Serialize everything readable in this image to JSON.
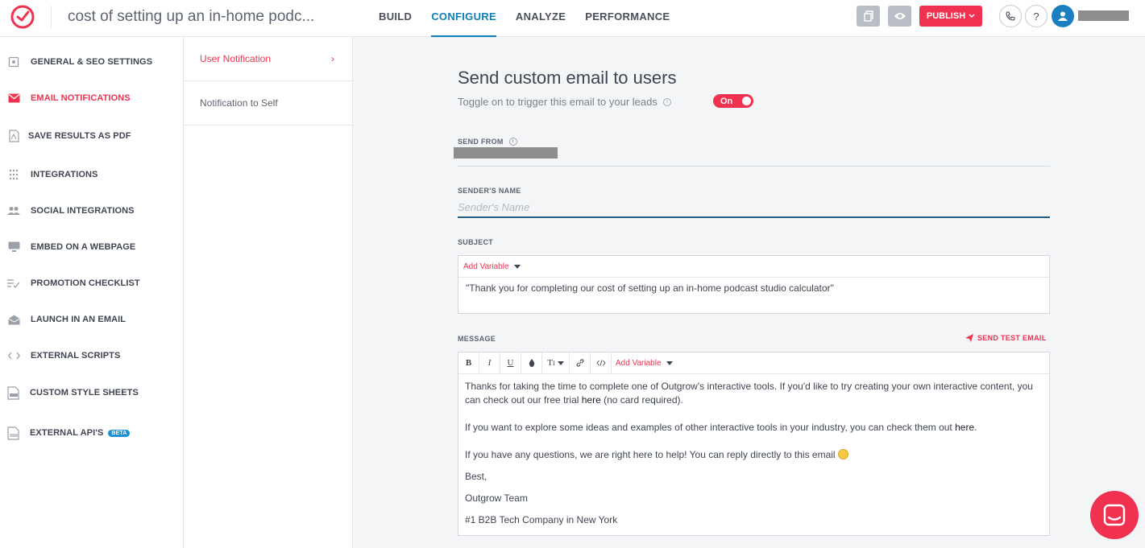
{
  "app": {
    "title": "cost of setting up an in-home podc..."
  },
  "nav": {
    "tabs": [
      {
        "label": "BUILD"
      },
      {
        "label": "CONFIGURE",
        "active": true
      },
      {
        "label": "ANALYZE"
      },
      {
        "label": "PERFORMANCE"
      }
    ]
  },
  "toolbar": {
    "publish_label": "PUBLISH",
    "help_label": "?"
  },
  "sidebar": {
    "items": [
      {
        "label": "GENERAL & SEO SETTINGS",
        "icon": "settings-icon"
      },
      {
        "label": "EMAIL NOTIFICATIONS",
        "icon": "mail-icon",
        "active": true
      },
      {
        "label": "SAVE RESULTS AS PDF",
        "icon": "pdf-icon"
      },
      {
        "label": "INTEGRATIONS",
        "icon": "grid-icon"
      },
      {
        "label": "SOCIAL INTEGRATIONS",
        "icon": "people-icon"
      },
      {
        "label": "EMBED ON A WEBPAGE",
        "icon": "monitor-icon"
      },
      {
        "label": "PROMOTION CHECKLIST",
        "icon": "checklist-icon"
      },
      {
        "label": "LAUNCH IN AN EMAIL",
        "icon": "envelope-open-icon"
      },
      {
        "label": "EXTERNAL SCRIPTS",
        "icon": "code-icon"
      },
      {
        "label": "CUSTOM STYLE SHEETS",
        "icon": "css-file-icon"
      },
      {
        "label": "EXTERNAL API'S",
        "icon": "api-file-icon",
        "badge": "BETA"
      }
    ]
  },
  "subnav": {
    "items": [
      {
        "label": "User Notification",
        "active": true
      },
      {
        "label": "Notification to Self"
      }
    ]
  },
  "main": {
    "heading": "Send custom email to users",
    "subheading": "Toggle on to trigger this email to your leads",
    "toggle_label": "On",
    "send_from_label": "SEND FROM",
    "senders_name_label": "SENDER'S NAME",
    "senders_name_placeholder": "Sender's Name",
    "senders_name_value": "",
    "subject_label": "SUBJECT",
    "add_variable_label": "Add Variable",
    "subject_text": "\"Thank you for completing our cost of setting up an in-home podcast studio calculator\"",
    "message_label": "MESSAGE",
    "send_test_label": "SEND TEST EMAIL",
    "editor_tools": [
      {
        "label": "B",
        "icon": "bold-icon"
      },
      {
        "label": "I",
        "icon": "italic-icon"
      },
      {
        "label": "U",
        "icon": "underline-icon"
      },
      {
        "label": "",
        "icon": "color-drop-icon"
      },
      {
        "label": "T",
        "icon": "font-size-icon"
      },
      {
        "label": "",
        "icon": "link-icon"
      },
      {
        "label": "",
        "icon": "code-view-icon"
      }
    ],
    "message": {
      "p1_a": "Thanks for taking the time to complete one of Outgrow's interactive tools. If you'd like to try creating your own interactive content, you can check out our free trial ",
      "p1_link": "here",
      "p1_b": " (no card required).",
      "p2_a": "If you want to explore some ideas and examples of other interactive tools in your industry, you can check them out ",
      "p2_link": "here",
      "p2_b": ".",
      "p3": "If you have any questions, we are right here to help! You can reply directly to this email ",
      "p4": "Best,",
      "p5": "Outgrow Team",
      "p6": "#1 B2B Tech Company in New York"
    }
  },
  "colors": {
    "accent": "#f0314f",
    "primary_blue": "#0d7fb9",
    "text": "#3f4550"
  }
}
